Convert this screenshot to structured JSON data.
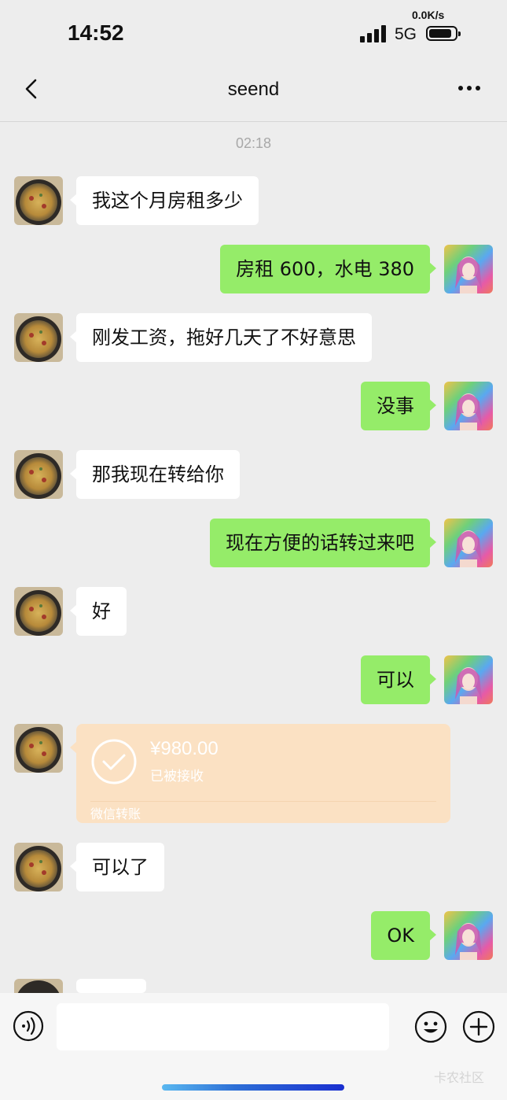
{
  "status_bar": {
    "time": "14:52",
    "net_speed": "0.0K/s",
    "network": "5G"
  },
  "nav": {
    "title": "seend"
  },
  "chat": {
    "timestamp": "02:18",
    "messages": [
      {
        "side": "left",
        "text": "我这个月房租多少"
      },
      {
        "side": "right",
        "text": "房租 600，水电 380"
      },
      {
        "side": "left",
        "text": "刚发工资，拖好几天了不好意思"
      },
      {
        "side": "right",
        "text": "没事"
      },
      {
        "side": "left",
        "text": "那我现在转给你"
      },
      {
        "side": "right",
        "text": "现在方便的话转过来吧"
      },
      {
        "side": "left",
        "text": "好"
      },
      {
        "side": "right",
        "text": "可以"
      },
      {
        "side": "left",
        "type": "transfer",
        "amount": "¥980.00",
        "status": "已被接收",
        "label": "微信转账"
      },
      {
        "side": "left",
        "text": "可以了"
      },
      {
        "side": "right",
        "text": "OK"
      }
    ]
  },
  "input_bar": {
    "placeholder": ""
  },
  "watermark": "卡农社区",
  "colors": {
    "background": "#ededed",
    "bubble_self": "#95ec69",
    "bubble_other": "#ffffff",
    "transfer": "#fbe1c3"
  },
  "icons": [
    "back-arrow-icon",
    "more-icon",
    "voice-icon",
    "emoji-icon",
    "add-icon",
    "check-circle-icon"
  ]
}
